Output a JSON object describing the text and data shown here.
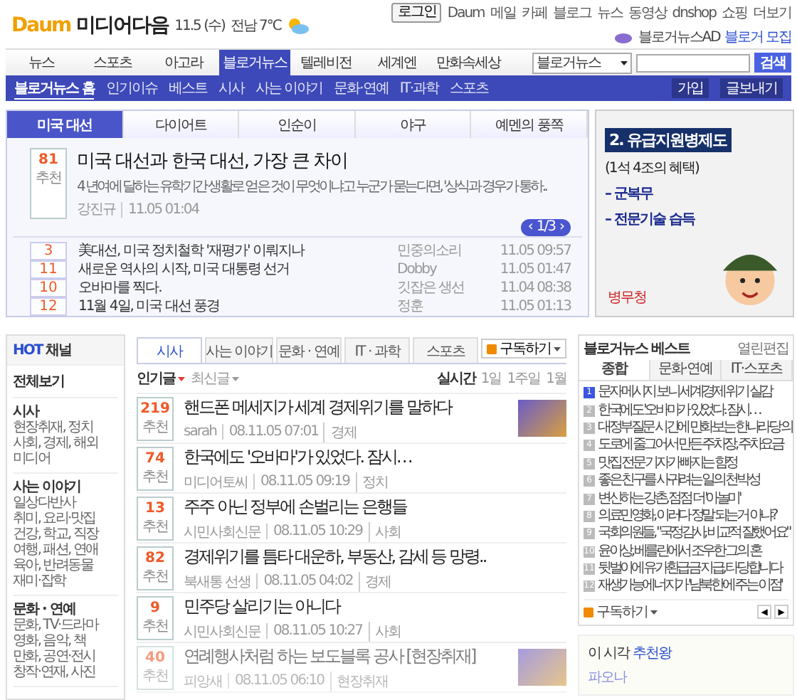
{
  "header": {
    "logo": "Daum",
    "service": "미디어다음",
    "date": "11.5 (수)",
    "weather": "전남 7°C",
    "login": "로그인",
    "links": [
      "Daum",
      "메일",
      "카페",
      "블로그",
      "뉴스",
      "동영상",
      "dnshop",
      "쇼핑"
    ],
    "more": "더보기",
    "ad_label": "블로거뉴스AD",
    "ad_link": "블로거 모집"
  },
  "main_nav": [
    {
      "label": "뉴스",
      "selected": false
    },
    {
      "label": "스포츠",
      "selected": false
    },
    {
      "label": "아고라",
      "selected": false
    },
    {
      "label": "블로거뉴스",
      "selected": true
    },
    {
      "label": "텔레비전",
      "selected": false
    },
    {
      "label": "세계엔",
      "selected": false
    },
    {
      "label": "만화속세상",
      "selected": false
    }
  ],
  "search": {
    "scope": "블로거뉴스",
    "button": "검색"
  },
  "sub_nav": [
    {
      "label": "블로거뉴스 홈",
      "selected": true
    },
    {
      "label": "인기이슈",
      "selected": false
    },
    {
      "label": "베스트",
      "selected": false
    },
    {
      "label": "시사",
      "selected": false
    },
    {
      "label": "사는 이야기",
      "selected": false
    },
    {
      "label": "문화·연예",
      "selected": false
    },
    {
      "label": "IT·과학",
      "selected": false
    },
    {
      "label": "스포츠",
      "selected": false
    }
  ],
  "sub_buttons": [
    "가입",
    "글보내기"
  ],
  "featured": {
    "tabs": [
      {
        "label": "미국 대선",
        "selected": true
      },
      {
        "label": "다이어트",
        "selected": false
      },
      {
        "label": "인순이",
        "selected": false
      },
      {
        "label": "야구",
        "selected": false
      },
      {
        "label": "예멘의 풍쪽",
        "selected": false
      }
    ],
    "top": {
      "count": "81",
      "unit": "추천",
      "title": "미국 대선과 한국 대선, 가장 큰 차이",
      "summary": "4 년여에 달하는 유학기간 생활로 얻은 것이 무엇이냐고 누군가 묻는다면, '상식과 경우가 통하..",
      "author": "강진규",
      "time": "11.05 01:04"
    },
    "pager": {
      "prev": "‹",
      "label": "1/3",
      "next": "›"
    },
    "items": [
      {
        "count": "3",
        "title": "美대선, 미국 정치철학 '재평가' 이뤄지나",
        "author": "민중의소리",
        "time": "11.05 09:57"
      },
      {
        "count": "11",
        "title": "새로운 역사의 시작, 미국 대통령 선거",
        "author": "Dobby",
        "time": "11.05 01:47"
      },
      {
        "count": "10",
        "title": "오바마를 찍다.",
        "author": "깃잡은 생선",
        "time": "11.04 08:38"
      },
      {
        "count": "12",
        "title": "11월 4일, 미국 대선 풍경",
        "author": "정훈",
        "time": "11.05 01:13"
      }
    ]
  },
  "ad": {
    "heading": "2. 유급지원병제도",
    "subheading": "(1석 4조의 혜택)",
    "points": [
      "– 군복무",
      "– 전문기술 습득"
    ],
    "badge": "병무청"
  },
  "hot_channel": {
    "hot": "HOT",
    "title": "채널",
    "all": "전체보기",
    "groups": [
      {
        "title": "시사",
        "items": [
          "현장취재, 정치",
          "사회, 경제, 해외",
          "미디어"
        ]
      },
      {
        "title": "사는 이야기",
        "items": [
          "일상다반사",
          "취미, 요리·맛집",
          "건강, 학교, 직장",
          "여행, 패션, 연애",
          "육아, 반려동물",
          "재미·잡학"
        ]
      },
      {
        "title": "문화 · 연예",
        "items": [
          "문화, TV·드라마",
          "영화, 음악, 책",
          "만화, 공연·전시",
          "창작·연재, 사진"
        ]
      }
    ]
  },
  "news": {
    "tabs": [
      {
        "label": "시사",
        "selected": true
      },
      {
        "label": "사는 이야기",
        "selected": false
      },
      {
        "label": "문화 · 연예",
        "selected": false
      },
      {
        "label": "IT · 과학",
        "selected": false
      },
      {
        "label": "스포츠",
        "selected": false
      }
    ],
    "subscribe": "구독하기",
    "sorts": [
      {
        "label": "인기글",
        "selected": true
      },
      {
        "label": "최신글",
        "selected": false
      }
    ],
    "periods": [
      {
        "label": "실시간",
        "selected": true
      },
      {
        "label": "1일",
        "selected": false
      },
      {
        "label": "1주일",
        "selected": false
      },
      {
        "label": "1월",
        "selected": false
      }
    ],
    "rows": [
      {
        "count": "219",
        "unit": "추천",
        "title": "핸드폰 메세지가 세계 경제위기를 말하다",
        "author": "sarah",
        "time": "08.11.05 07:01",
        "category": "경제",
        "thumbnail": true,
        "faded": false
      },
      {
        "count": "74",
        "unit": "추천",
        "title": "한국에도 '오바마'가 있었다. 잠시…",
        "author": "미디어토씨",
        "time": "08.11.05 09:19",
        "category": "정치",
        "thumbnail": false,
        "faded": false
      },
      {
        "count": "13",
        "unit": "추천",
        "title": "주주 아닌 정부에 손벌리는 은행들",
        "author": "시민사회신문",
        "time": "08.11.05 10:29",
        "category": "사회",
        "thumbnail": false,
        "faded": false
      },
      {
        "count": "82",
        "unit": "추천",
        "title": "경제위기를 틈타 대운하, 부동산, 감세 등 망령..",
        "author": "북새통 선생",
        "time": "08.11.05 04:02",
        "category": "경제",
        "thumbnail": false,
        "faded": false
      },
      {
        "count": "9",
        "unit": "추천",
        "title": "민주당 살리기는 아니다",
        "author": "시민사회신문",
        "time": "08.11.05 10:27",
        "category": "사회",
        "thumbnail": false,
        "faded": false
      },
      {
        "count": "40",
        "unit": "추천",
        "title": "연례행사처럼 하는 보도블록 공사 [현장취재]",
        "author": "피앙새",
        "time": "08.11.05 06:10",
        "category": "현장취재",
        "thumbnail": true,
        "faded": true
      }
    ]
  },
  "best": {
    "title": "블로거뉴스 베스트",
    "edit": "열린편집",
    "tabs": [
      {
        "label": "종합",
        "selected": true
      },
      {
        "label": "문화·연예",
        "selected": false
      },
      {
        "label": "IT·스포츠",
        "selected": false
      }
    ],
    "items": [
      {
        "rank": "1",
        "title": "문자 메시지 보니 세계경제 위기 실감",
        "highlight": true
      },
      {
        "rank": "2",
        "title": "한국에도 '오바마가 있었다. 잠시…",
        "highlight": false
      },
      {
        "rank": "3",
        "title": "대정부질문 시간에 만화보는 한나라당 의",
        "highlight": false
      },
      {
        "rank": "4",
        "title": "도로에 줄그어서 만든 주차장, 주차요금",
        "highlight": false
      },
      {
        "rank": "5",
        "title": "맛집 전문 기자가 빠지는 함정",
        "highlight": false
      },
      {
        "rank": "6",
        "title": "좋은 친구를 사귀려는 일의 천박성",
        "highlight": false
      },
      {
        "rank": "7",
        "title": "변신하는 강촌, 점점 더 '아놀미'",
        "highlight": false
      },
      {
        "rank": "8",
        "title": "의료민영화, 이러다 정말 되는거 아냐?",
        "highlight": false
      },
      {
        "rank": "9",
        "title": "국회의원들, \"국정감사, 비교적 잘했어요\"",
        "highlight": false
      },
      {
        "rank": "10",
        "title": "윤이상, 베를린에서 조우한 그의 혼",
        "highlight": false
      },
      {
        "rank": "11",
        "title": "뒷벌이에 유가환급금 지급, 타당합니다",
        "highlight": false
      },
      {
        "rank": "12",
        "title": "재생가능에너지가 '남북한에 주는 이점'",
        "highlight": false
      }
    ],
    "subscribe": "구독하기",
    "prev": "◀",
    "next": "▶"
  },
  "recommend": {
    "label": "이 시각",
    "link": "추천왕",
    "name": "파오나"
  }
}
